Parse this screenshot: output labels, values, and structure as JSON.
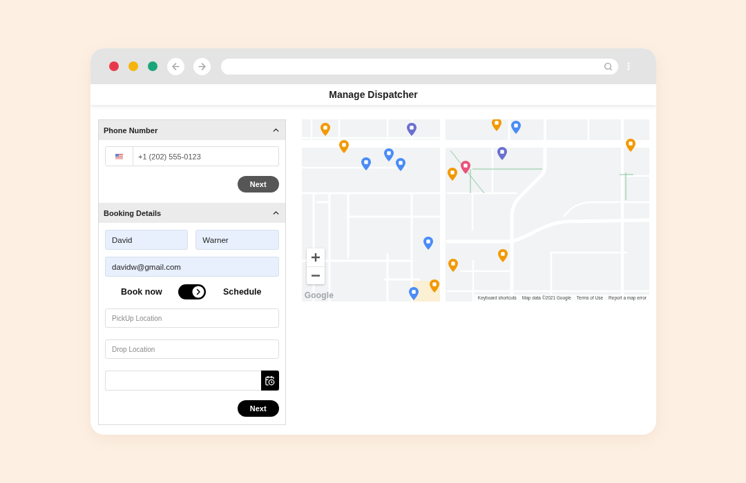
{
  "window": {
    "controls": [
      {
        "color": "#e8394a"
      },
      {
        "color": "#f5b50c"
      },
      {
        "color": "#1aa57a"
      }
    ]
  },
  "page": {
    "title": "Manage Dispatcher"
  },
  "phone_section": {
    "title": "Phone Number",
    "expanded": true,
    "phone": {
      "value": "+1 (202) 555-0123"
    },
    "next_button": {
      "label": "Next",
      "disabled": true
    }
  },
  "booking_section": {
    "title": "Booking Details",
    "expanded": true,
    "name_fields": [
      {
        "value": "David",
        "autofilled": true
      },
      {
        "value": "Warner",
        "autofilled": true
      }
    ],
    "email": {
      "value": "davidw@gmail.com",
      "autofilled": true
    },
    "mode_toggle": {
      "left_label": "Book now",
      "right_label": "Schedule",
      "on": true
    },
    "location_fields": [
      {
        "placeholder": "PickUp Location"
      },
      {
        "placeholder": "Drop Location"
      }
    ],
    "next_button": {
      "label": "Next",
      "disabled": false
    }
  },
  "map": {
    "logo": "Google",
    "attribution": [
      "Keyboard shortcuts",
      "Map data ©2021 Google",
      "Terms of Use",
      "Report a map error"
    ]
  }
}
